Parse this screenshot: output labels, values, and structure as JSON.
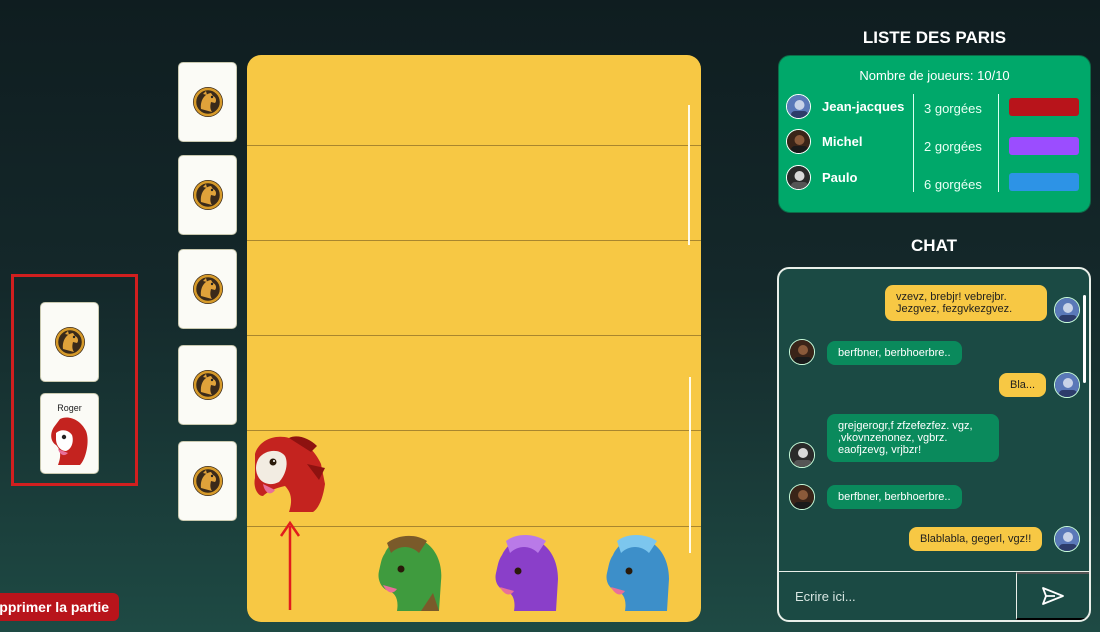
{
  "deck": {
    "face_card_name": "Roger"
  },
  "actions": {
    "delete_label": "pprimer la partie"
  },
  "bets": {
    "title": "LISTE DES PARIS",
    "players_count": "Nombre de joueurs: 10/10",
    "rows": [
      {
        "name": "Jean-jacques",
        "sips": "3 gorgées",
        "color": "#b8141b"
      },
      {
        "name": "Michel",
        "sips": "2 gorgées",
        "color": "#9b4dff"
      },
      {
        "name": "Paulo",
        "sips": "6 gorgées",
        "color": "#2d93e6"
      }
    ]
  },
  "chat": {
    "title": "CHAT",
    "messages": [
      {
        "from": "me",
        "text_lines": [
          "vzevz, brebjr! vebrejbr.",
          "Jezgvez, fezgvkezgvez."
        ]
      },
      {
        "from": "them",
        "text": "berfbner, berbhoerbre.."
      },
      {
        "from": "me",
        "text": "Bla..."
      },
      {
        "from": "them",
        "text_lines": [
          "grejgerogr,f zfzefezfez. vgz,",
          ",vkovnzenonez, vgbrz.",
          "eaofjzevg, vrjbzr!"
        ]
      },
      {
        "from": "them",
        "text": "berfbner, berbhoerbre.."
      },
      {
        "from": "me",
        "text": "Blablabla, gegerl, vgz!!"
      }
    ],
    "input_placeholder": "Ecrire ici..."
  },
  "colors": {
    "board": "#f7c844",
    "bets_bg": "#00a86a",
    "red_horse": "#c4231f",
    "green_horse": "#3f9b3e",
    "purple_horse": "#8a3fc9",
    "blue_horse": "#3d8fc9"
  },
  "icons": {
    "card_back": "horse-emblem-icon",
    "send": "send-icon",
    "arrow": "arrow-up-icon"
  }
}
